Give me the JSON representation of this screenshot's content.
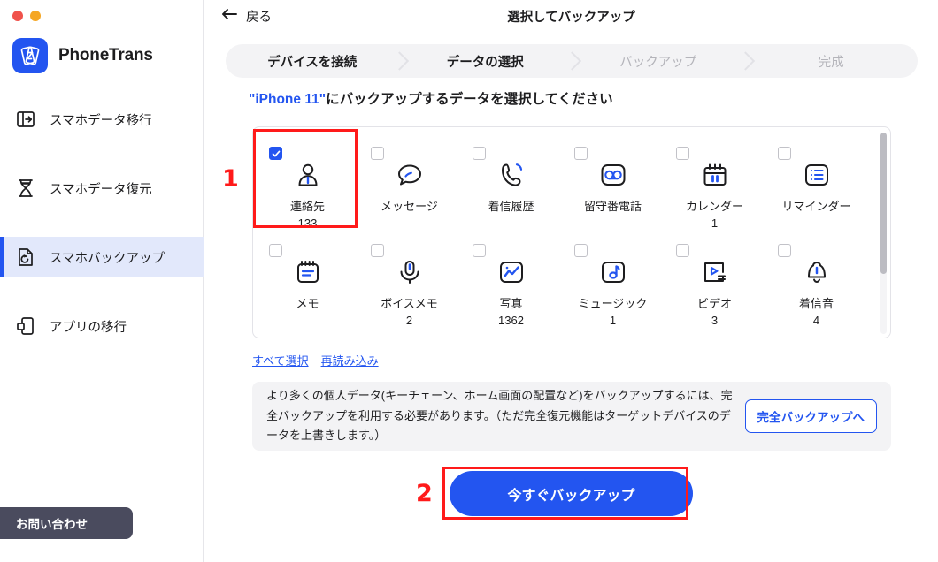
{
  "window": {
    "controls": [
      "close",
      "minimize"
    ]
  },
  "sidebar": {
    "brand": "PhoneTrans",
    "items": [
      {
        "label": "スマホデータ移行",
        "icon": "transfer-icon",
        "active": false
      },
      {
        "label": "スマホデータ復元",
        "icon": "hourglass-icon",
        "active": false
      },
      {
        "label": "スマホバックアップ",
        "icon": "backup-restore-icon",
        "active": true
      },
      {
        "label": "アプリの移行",
        "icon": "app-move-icon",
        "active": false
      }
    ],
    "contact_label": "お問い合わせ"
  },
  "header": {
    "back_label": "戻る",
    "title": "選択してバックアップ"
  },
  "steps": [
    {
      "label": "デバイスを接続",
      "state": "done"
    },
    {
      "label": "データの選択",
      "state": "current"
    },
    {
      "label": "バックアップ",
      "state": "pending"
    },
    {
      "label": "完成",
      "state": "pending"
    }
  ],
  "section": {
    "device": "\"iPhone 11\"",
    "title_rest": "にバックアップするデータを選択してください"
  },
  "grid": {
    "rows": [
      [
        {
          "name": "連絡先",
          "count": "133",
          "icon": "contacts-icon",
          "checked": true
        },
        {
          "name": "メッセージ",
          "count": "",
          "icon": "messages-icon",
          "checked": false
        },
        {
          "name": "着信履歴",
          "count": "",
          "icon": "call-history-icon",
          "checked": false
        },
        {
          "name": "留守番電話",
          "count": "",
          "icon": "voicemail-icon",
          "checked": false
        },
        {
          "name": "カレンダー",
          "count": "1",
          "icon": "calendar-icon",
          "checked": false
        },
        {
          "name": "リマインダー",
          "count": "",
          "icon": "reminders-icon",
          "checked": false
        }
      ],
      [
        {
          "name": "メモ",
          "count": "",
          "icon": "notes-icon",
          "checked": false
        },
        {
          "name": "ボイスメモ",
          "count": "2",
          "icon": "voice-memo-icon",
          "checked": false
        },
        {
          "name": "写真",
          "count": "1362",
          "icon": "photos-icon",
          "checked": false
        },
        {
          "name": "ミュージック",
          "count": "1",
          "icon": "music-icon",
          "checked": false
        },
        {
          "name": "ビデオ",
          "count": "3",
          "icon": "video-icon",
          "checked": false
        },
        {
          "name": "着信音",
          "count": "4",
          "icon": "ringtone-icon",
          "checked": false
        }
      ]
    ]
  },
  "links": {
    "select_all": "すべて選択",
    "reload": "再読み込み"
  },
  "info": {
    "text": "より多くの個人データ(キーチェーン、ホーム画面の配置など)をバックアップするには、完全バックアップを利用する必要があります。（ただ完全復元機能はターゲットデバイスのデータを上書きします。）",
    "button": "完全バックアップへ"
  },
  "cta": {
    "label": "今すぐバックアップ"
  },
  "annotations": [
    {
      "number": "1",
      "target": "連絡先"
    },
    {
      "number": "2",
      "target": "今すぐバックアップ"
    }
  ],
  "colors": {
    "accent": "#2355f0",
    "annotation": "#ff1a1a",
    "sidebar_active": "#e2e8fb",
    "panel_gray": "#f3f3f5"
  }
}
